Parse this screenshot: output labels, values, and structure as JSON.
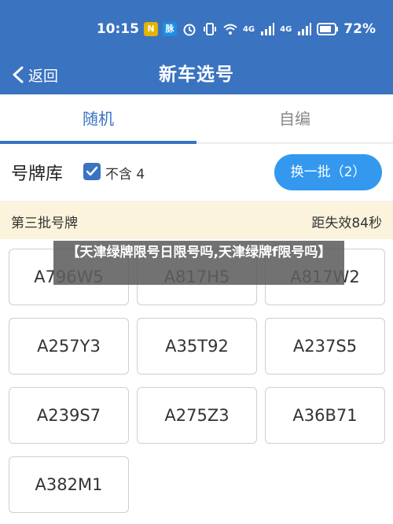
{
  "status_bar": {
    "time": "10:15",
    "badge_1": "N",
    "badge_2": "脉",
    "signal_1": "4G",
    "signal_2": "4G",
    "battery": "72%"
  },
  "nav": {
    "back_label": "返回",
    "title": "新车选号"
  },
  "tabs": [
    {
      "label": "随机",
      "active": true
    },
    {
      "label": "自编",
      "active": false
    }
  ],
  "plate_pool": {
    "title": "号牌库",
    "checkbox_label": "不含 4",
    "checkbox_checked": true,
    "refresh_label": "换一批（2）"
  },
  "batch": {
    "label": "第三批号牌",
    "timer": "距失效84秒"
  },
  "plates": [
    "A796W5",
    "A817H5",
    "A817W2",
    "A257Y3",
    "A35T92",
    "A237S5",
    "A239S7",
    "A275Z3",
    "A36B71",
    "A382M1"
  ],
  "overlay": {
    "caption": "【天津绿牌限号日限号吗,天津绿牌f限号吗】"
  },
  "colors": {
    "primary": "#3a73c0",
    "button": "#3498ef",
    "banner": "#fbf3dc"
  }
}
